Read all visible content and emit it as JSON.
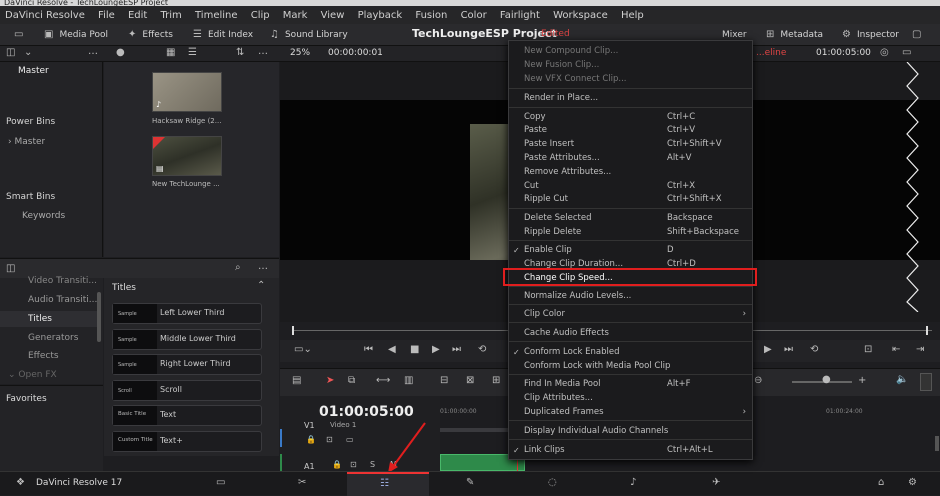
{
  "window_title": "DaVinci Resolve - TechLoungeESP Project",
  "menu": [
    "DaVinci Resolve",
    "File",
    "Edit",
    "Trim",
    "Timeline",
    "Clip",
    "Mark",
    "View",
    "Playback",
    "Fusion",
    "Color",
    "Fairlight",
    "Workspace",
    "Help"
  ],
  "toolbar": {
    "media_pool": "Media Pool",
    "effects": "Effects",
    "edit_index": "Edit Index",
    "sound_library": "Sound Library",
    "project_name": "TechLoungeESP Project",
    "edited": "Edited",
    "mixer": "Mixer",
    "metadata": "Metadata",
    "inspector": "Inspector"
  },
  "viewer": {
    "zoom": "25%",
    "timecode_left": "00:00:00:01",
    "timeline_name": "...eline",
    "timecode_right": "01:00:05:00"
  },
  "left_panel": {
    "master": "Master",
    "power_bins": "Power Bins",
    "power_master": "Master",
    "smart_bins": "Smart Bins",
    "keywords": "Keywords"
  },
  "media_pool": {
    "clips": [
      "Hacksaw Ridge (2...",
      "New TechLounge ..."
    ]
  },
  "effects_panel": {
    "categories": [
      "Video Transiti...",
      "Audio Transiti...",
      "Titles",
      "Generators",
      "Effects",
      "Open FX"
    ],
    "favorites": "Favorites",
    "titles_header": "Titles",
    "items": [
      {
        "thumb": "Sample",
        "label": "Left Lower Third"
      },
      {
        "thumb": "Sample",
        "label": "Middle Lower Third"
      },
      {
        "thumb": "Sample",
        "label": "Right Lower Third"
      },
      {
        "thumb": "Scroll",
        "label": "Scroll"
      },
      {
        "thumb": "Basic Title",
        "label": "Text"
      },
      {
        "thumb": "Custom Title",
        "label": "Text+"
      }
    ]
  },
  "timeline": {
    "timecode": "01:00:05:00",
    "ruler_left": "01:00:00:00",
    "ruler_right": "01:00:24:00",
    "track_v1": "V1",
    "track_v1_name": "Video 1",
    "track_a1": "A1"
  },
  "context_menu": {
    "items": [
      {
        "label": "New Compound Clip...",
        "shortcut": "",
        "dim": true
      },
      {
        "label": "New Fusion Clip...",
        "shortcut": "",
        "dim": true
      },
      {
        "label": "New VFX Connect Clip...",
        "shortcut": "",
        "dim": true
      },
      {
        "label": "Render in Place...",
        "shortcut": "",
        "dim": false
      },
      {
        "label": "Copy",
        "shortcut": "Ctrl+C",
        "dim": false
      },
      {
        "label": "Paste",
        "shortcut": "Ctrl+V",
        "dim": false
      },
      {
        "label": "Paste Insert",
        "shortcut": "Ctrl+Shift+V",
        "dim": false
      },
      {
        "label": "Paste Attributes...",
        "shortcut": "Alt+V",
        "dim": false
      },
      {
        "label": "Remove Attributes...",
        "shortcut": "",
        "dim": false
      },
      {
        "label": "Cut",
        "shortcut": "Ctrl+X",
        "dim": false
      },
      {
        "label": "Ripple Cut",
        "shortcut": "Ctrl+Shift+X",
        "dim": false
      },
      {
        "label": "Delete Selected",
        "shortcut": "Backspace",
        "dim": false
      },
      {
        "label": "Ripple Delete",
        "shortcut": "Shift+Backspace",
        "dim": false
      },
      {
        "label": "Enable Clip",
        "shortcut": "D",
        "dim": false,
        "checked": true
      },
      {
        "label": "Change Clip Duration...",
        "shortcut": "Ctrl+D",
        "dim": false
      },
      {
        "label": "Change Clip Speed...",
        "shortcut": "",
        "dim": false,
        "highlight": true
      },
      {
        "label": "Normalize Audio Levels...",
        "shortcut": "",
        "dim": false
      },
      {
        "label": "Clip Color",
        "shortcut": "",
        "dim": false,
        "submenu": true
      },
      {
        "label": "Cache Audio Effects",
        "shortcut": "",
        "dim": false
      },
      {
        "label": "Conform Lock Enabled",
        "shortcut": "",
        "dim": false,
        "checked": true
      },
      {
        "label": "Conform Lock with Media Pool Clip",
        "shortcut": "",
        "dim": false
      },
      {
        "label": "Find In Media Pool",
        "shortcut": "Alt+F",
        "dim": false
      },
      {
        "label": "Clip Attributes...",
        "shortcut": "",
        "dim": false
      },
      {
        "label": "Duplicated Frames",
        "shortcut": "",
        "dim": false,
        "submenu": true
      },
      {
        "label": "Display Individual Audio Channels",
        "shortcut": "",
        "dim": false
      },
      {
        "label": "Link Clips",
        "shortcut": "Ctrl+Alt+L",
        "dim": false,
        "checked": true
      }
    ]
  },
  "pagebar": {
    "app_name": "DaVinci Resolve 17"
  },
  "colors": {
    "highlight_box": "#e01e1e",
    "edited_red": "#d44444",
    "audio_clip_green": "#2e8a4a"
  }
}
